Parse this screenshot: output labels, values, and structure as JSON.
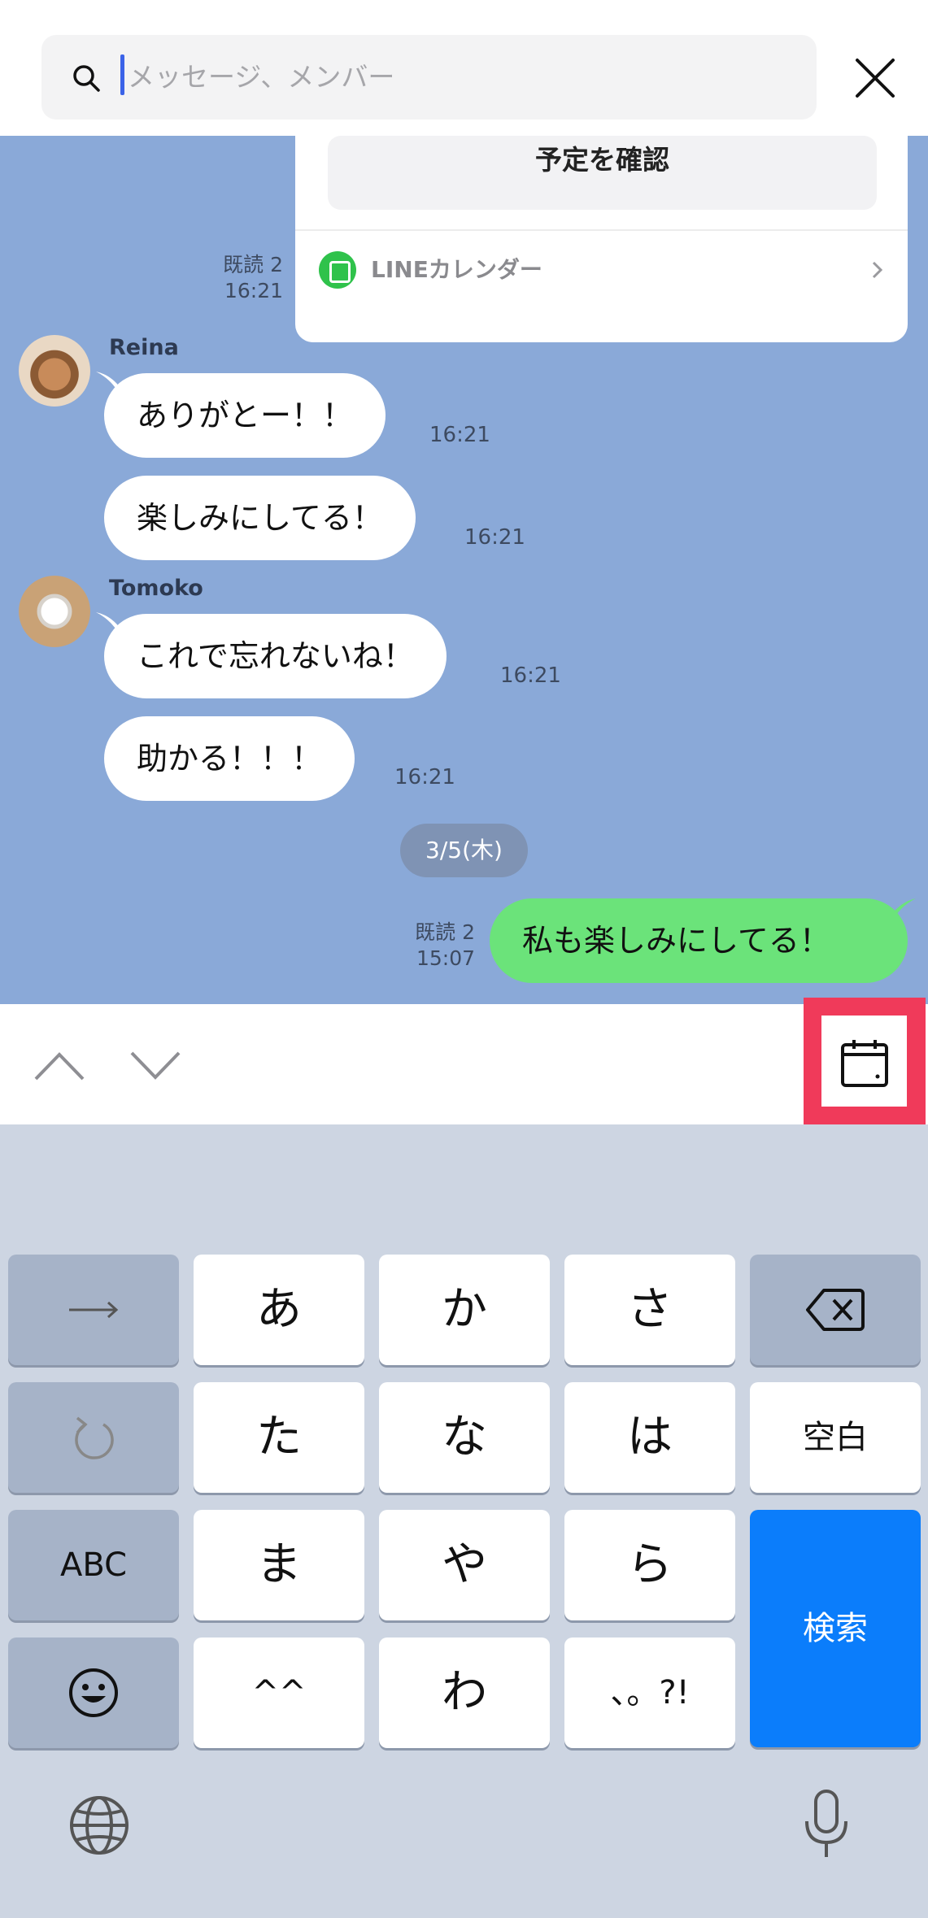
{
  "search": {
    "placeholder": "メッセージ、メンバー",
    "search_icon": "search-icon",
    "close_icon": "close-icon"
  },
  "calendar_card": {
    "confirm_label": "予定を確認",
    "app_name": "LINEカレンダー",
    "read_status": "既読 2",
    "time": "16:21"
  },
  "messages": [
    {
      "sender": "Reina",
      "text": "ありがとー！！",
      "time": "16:21"
    },
    {
      "sender": "",
      "text": "楽しみにしてる！",
      "time": "16:21"
    },
    {
      "sender": "Tomoko",
      "text": "これで忘れないね！",
      "time": "16:21"
    },
    {
      "sender": "",
      "text": "助かる！！！",
      "time": "16:21"
    }
  ],
  "date_divider": "3/5(木)",
  "outgoing": {
    "text": "私も楽しみにしてる！",
    "read_status": "既読 2",
    "time": "15:07"
  },
  "nav": {
    "up_icon": "chevron-up-icon",
    "down_icon": "chevron-down-icon",
    "calendar_icon": "calendar-icon"
  },
  "keyboard": {
    "rows": [
      [
        "→",
        "あ",
        "か",
        "さ",
        "⌫"
      ],
      [
        "↺",
        "た",
        "な",
        "は",
        "空白"
      ],
      [
        "ABC",
        "ま",
        "や",
        "ら",
        "検索"
      ],
      [
        "☺",
        "^^",
        "わ",
        "、。?!"
      ]
    ],
    "k_arrow": "→",
    "k_a": "あ",
    "k_ka": "か",
    "k_sa": "さ",
    "k_ta": "た",
    "k_na": "な",
    "k_ha": "は",
    "k_space": "空白",
    "k_abc": "ABC",
    "k_ma": "ま",
    "k_ya": "や",
    "k_ra": "ら",
    "k_search": "検索",
    "k_kao": "^^",
    "k_wa": "わ",
    "k_punct": "、。?!"
  },
  "colors": {
    "chat_bg": "#8aa9d8",
    "outgoing_bubble": "#6be37a",
    "highlight": "#f03a5a",
    "search_key": "#0b7dfb"
  }
}
